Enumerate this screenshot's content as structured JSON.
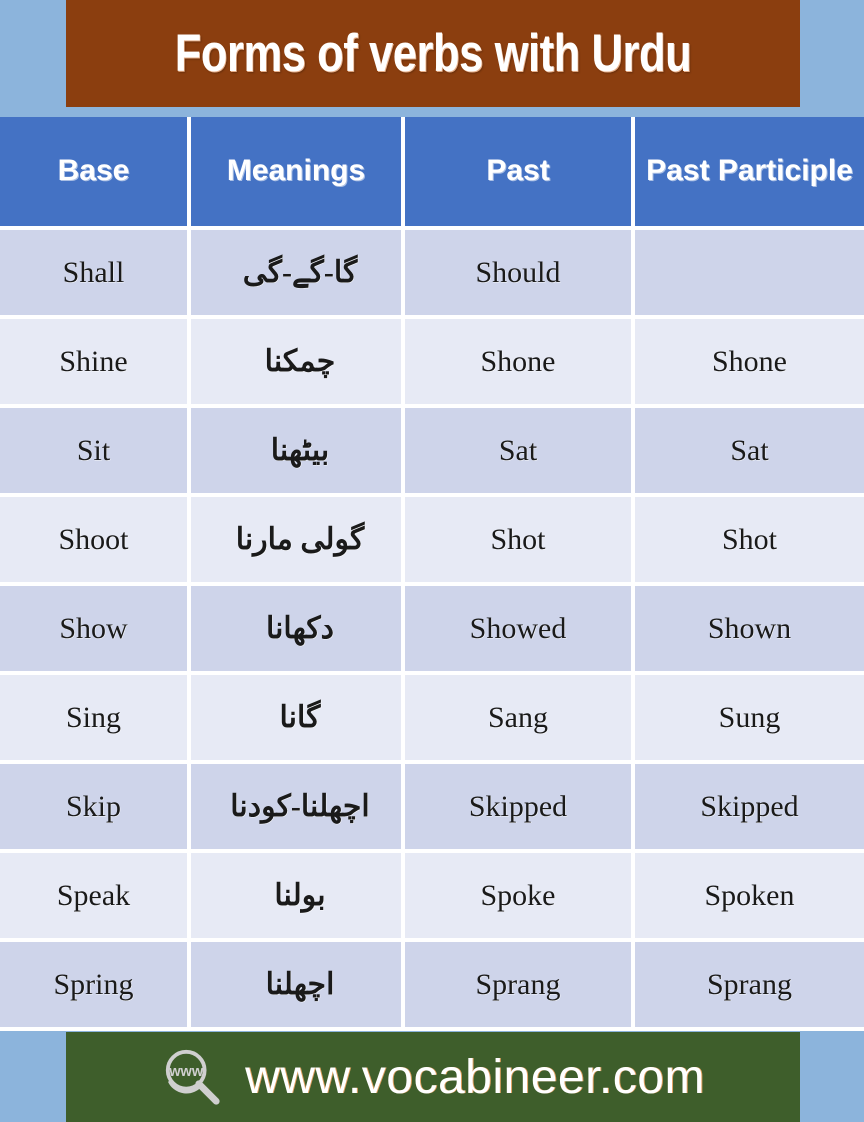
{
  "title": {
    "text": "Forms of verbs with Urdu",
    "background_color": "#8b3e0f",
    "text_color": "#ffffff"
  },
  "page": {
    "background_color": "#8cb4dc"
  },
  "table": {
    "header_background_color": "#4472c4",
    "row_color_odd": "#ced4ea",
    "row_color_even": "#e7eaf5",
    "columns": [
      "Base",
      "Meanings",
      "Past",
      "Past Participle"
    ],
    "rows": [
      {
        "base": "Shall",
        "meanings": "گا-گے-گی",
        "past": "Should",
        "past_participle": ""
      },
      {
        "base": "Shine",
        "meanings": "چمکنا",
        "past": "Shone",
        "past_participle": "Shone"
      },
      {
        "base": "Sit",
        "meanings": "بیٹھنا",
        "past": "Sat",
        "past_participle": "Sat"
      },
      {
        "base": "Shoot",
        "meanings": "گولی مارنا",
        "past": "Shot",
        "past_participle": "Shot"
      },
      {
        "base": "Show",
        "meanings": "دکھانا",
        "past": "Showed",
        "past_participle": "Shown"
      },
      {
        "base": "Sing",
        "meanings": "گانا",
        "past": "Sang",
        "past_participle": "Sung"
      },
      {
        "base": "Skip",
        "meanings": "اچھلنا-کودنا",
        "past": "Skipped",
        "past_participle": "Skipped"
      },
      {
        "base": "Speak",
        "meanings": "بولنا",
        "past": "Spoke",
        "past_participle": "Spoken"
      },
      {
        "base": "Spring",
        "meanings": "اچھلنا",
        "past": "Sprang",
        "past_participle": "Sprang"
      }
    ]
  },
  "footer": {
    "url": "www.vocabineer.com",
    "icon": "www-magnifier-icon",
    "background_color": "#3e5e2b",
    "text_color": "#ffffff",
    "icon_label": "www"
  }
}
